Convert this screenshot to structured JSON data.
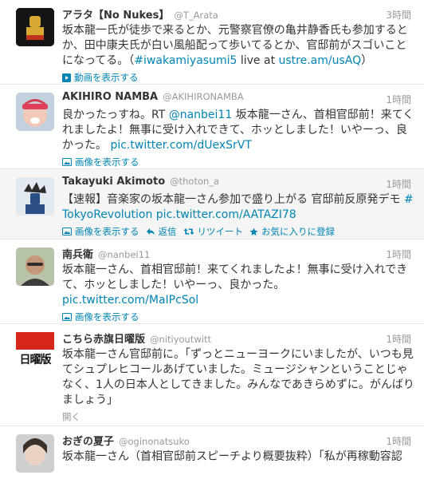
{
  "tweets": [
    {
      "name": "アラタ【No Nukes】",
      "handle": "@T_Arata",
      "time": "3時間",
      "text_pre": "坂本龍一氏が徒歩で来るとか、元警察官僚の亀井静香氏も参加するとか、田中康夫氏が白い風船配って歩いてるとか、官邸前がスゴいことになってる。（",
      "hashtag": "#iwakamiyasumi5",
      "text_mid": " live at ",
      "link": "ustre.am/usAQ",
      "text_post": "）",
      "action_label": "動画を表示する",
      "action_icon": "video-icon"
    },
    {
      "name": "AKIHIRO NAMBA",
      "handle": "@AKIHIRONAMBA",
      "time": "1時間",
      "text_pre": "良かったっすね。RT ",
      "mention": "@nanbei11",
      "text_mid": " 坂本龍一さん、首相官邸前！来てくれましたよ！無事に受け入れできて、ホッとしました！いやーっ、良かった。 ",
      "link": "pic.twitter.com/dUexSrVT",
      "action_label": "画像を表示する",
      "action_icon": "photo-icon"
    },
    {
      "name": "Takayuki Akimoto",
      "handle": "@thoton_a",
      "time": "1時間",
      "text_pre": "【速報】音楽家の坂本龍一さん参加で盛り上がる 官邸前反原発デモ ",
      "hashtag": "#TokyoRevolution",
      "text_mid": " ",
      "link": "pic.twitter.com/AATAZI78",
      "actions": [
        {
          "label": "画像を表示する",
          "icon": "photo-icon"
        },
        {
          "label": "返信",
          "icon": "reply-icon"
        },
        {
          "label": "リツイート",
          "icon": "retweet-icon"
        },
        {
          "label": "お気に入りに登録",
          "icon": "star-icon"
        }
      ]
    },
    {
      "name": "南兵衛",
      "handle": "@nanbei11",
      "time": "1時間",
      "text_pre": "坂本龍一さん、首相官邸前！来てくれましたよ！無事に受け入れできて、ホッとしました！いやーっ、良かった。",
      "link": "pic.twitter.com/MaIPcSol",
      "action_label": "画像を表示する",
      "action_icon": "photo-icon"
    },
    {
      "name": "こちら赤旗日曜版",
      "handle": "@nitiyoutwitt",
      "time": "1時間",
      "avatar_text": "日曜版",
      "text_pre": "坂本龍一さん官邸前に。「ずっとニューヨークにいましたが、いつも見てシュプレヒコールあげていました。ミュージシャンということじゃなく、1人の日本人としてきました。みんなであきらめずに。がんばりましょう」",
      "action_label": "開く"
    },
    {
      "name": "おぎの夏子",
      "handle": "@oginonatsuko",
      "time": "1時間",
      "text_pre": "坂本龍一さん（首相官邸前スピーチより概要抜粋）「私が再稼動容認"
    }
  ]
}
